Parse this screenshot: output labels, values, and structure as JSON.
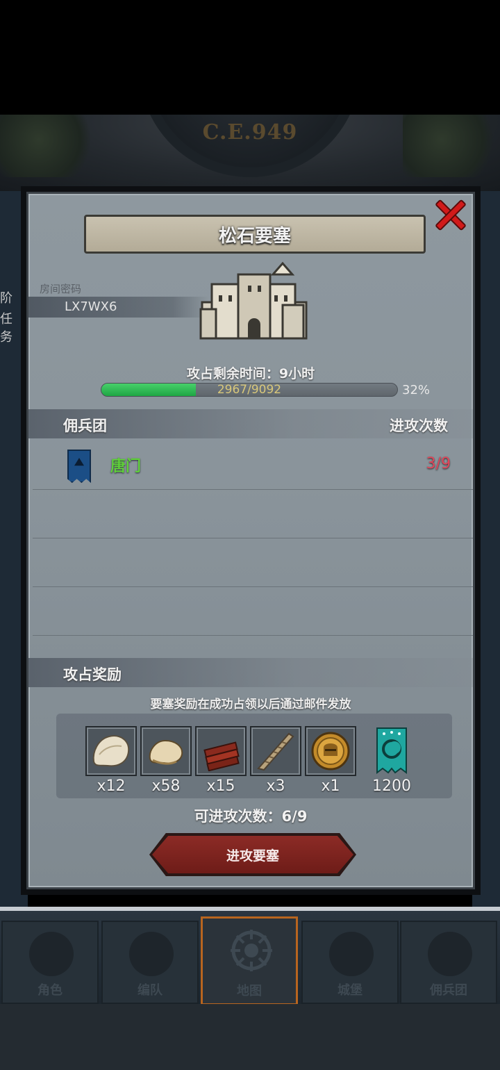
{
  "header": {
    "year": "C.E.949"
  },
  "side_tags": [
    "阶",
    "任务"
  ],
  "panel": {
    "title": "松石要塞",
    "room_label": "房间密码",
    "room_code": "LX7WX6",
    "time_text": "攻占剩余时间：9小时",
    "progress": {
      "text": "2967/9092",
      "current": 2967,
      "total": 9092,
      "percent_label": "32%",
      "fraction": 0.32
    },
    "mercenary_section": {
      "title": "佣兵团",
      "column_attacks": "进攻次数"
    },
    "guilds": [
      {
        "name": "唐门",
        "attacks": "3/9",
        "banner_color": "#1b4e86"
      }
    ],
    "reward_section": {
      "title": "攻占奖励",
      "note": "要塞奖励在成功占领以后通过邮件发放"
    },
    "rewards": [
      {
        "icon": "fur-pelt-icon",
        "qty": "x12"
      },
      {
        "icon": "wool-pelt-icon",
        "qty": "x58"
      },
      {
        "icon": "wood-planks-icon",
        "qty": "x15"
      },
      {
        "icon": "horn-icon",
        "qty": "x3"
      },
      {
        "icon": "knight-helmet-medal-icon",
        "qty": "x1"
      },
      {
        "icon": "teal-banner-icon",
        "qty": "1200"
      }
    ],
    "attack_count": "可进攻次数：6/9",
    "attack_button": "进攻要塞"
  },
  "nav": {
    "tabs": [
      {
        "label": "角色",
        "icon": "knight-icon"
      },
      {
        "label": "编队",
        "icon": "helmet-icon"
      },
      {
        "label": "地图",
        "icon": "compass-icon",
        "active": true
      },
      {
        "label": "城堡",
        "icon": "castle-icon"
      },
      {
        "label": "佣兵团",
        "icon": "banner-icon"
      }
    ]
  },
  "colors": {
    "accent_red": "#d11a1a",
    "progress_green": "#1fa644",
    "guild_green": "#5fcf3a",
    "attack_red": "#e0465a",
    "nav_active": "#b8651f"
  }
}
